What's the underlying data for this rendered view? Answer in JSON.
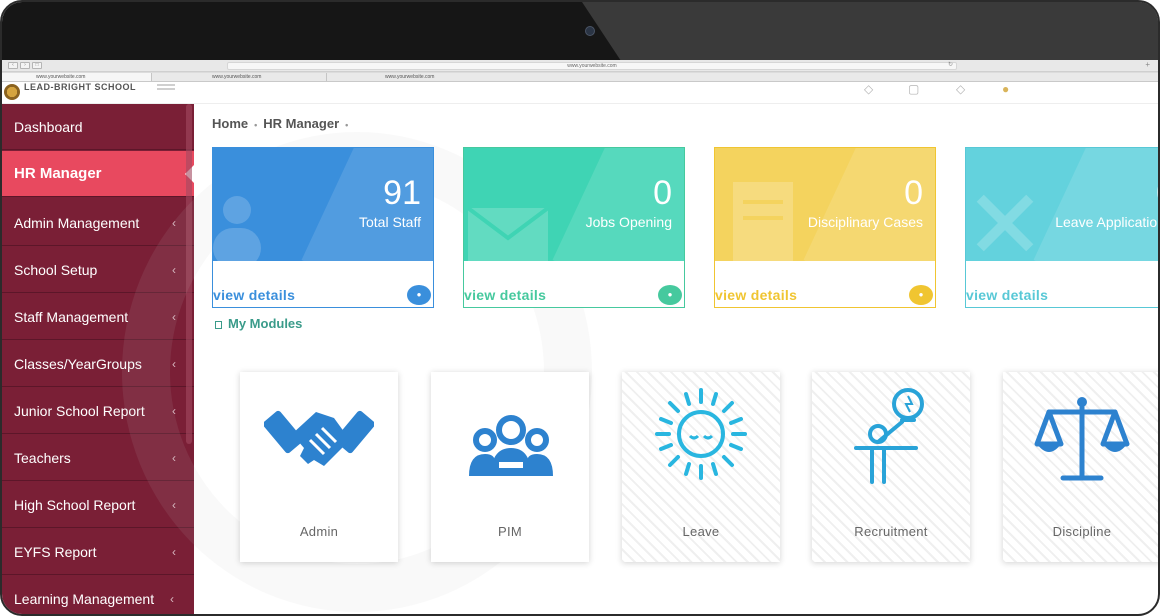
{
  "browser": {
    "address": "www.yourwebsite.com",
    "tabs": [
      "www.yourwebsite.com",
      "www.yourwebsite.com",
      "www.yourwebsite.com"
    ]
  },
  "header": {
    "brand": "LEAD-BRIGHT SCHOOL",
    "icons": [
      "bell-icon",
      "message-icon",
      "gear-icon",
      "user-icon"
    ]
  },
  "sidebar": {
    "items": [
      {
        "label": "Dashboard",
        "chevron": ""
      },
      {
        "label": "HR Manager",
        "chevron": ""
      },
      {
        "label": "Admin Management",
        "chevron": "‹"
      },
      {
        "label": "School Setup",
        "chevron": "‹"
      },
      {
        "label": "Staff Management",
        "chevron": "‹"
      },
      {
        "label": "Classes/YearGroups",
        "chevron": "‹"
      },
      {
        "label": "Junior School Report",
        "chevron": "‹"
      },
      {
        "label": "Teachers",
        "chevron": "‹"
      },
      {
        "label": "High School Report",
        "chevron": "‹"
      },
      {
        "label": "EYFS Report",
        "chevron": "‹"
      },
      {
        "label": "Learning Management",
        "chevron": "‹"
      }
    ]
  },
  "breadcrumb": {
    "home": "Home",
    "current": "HR Manager",
    "sep": "•"
  },
  "stats": [
    {
      "value": "91",
      "label": "Total Staff",
      "link": "view details",
      "color": "#3a8fdc",
      "accent": "#3a8fdc"
    },
    {
      "value": "0",
      "label": "Jobs Opening",
      "link": "view details",
      "color": "#3fd4b4",
      "accent": "#46c99e"
    },
    {
      "value": "0",
      "label": "Disciplinary Cases",
      "link": "view details",
      "color": "#f4d35e",
      "accent": "#f0c531"
    },
    {
      "value": "0",
      "label": "Leave Application",
      "link": "view details",
      "color": "#63d2dd",
      "accent": "#58c8d6"
    }
  ],
  "modules": {
    "title": "My Modules",
    "items": [
      {
        "label": "Admin",
        "icon": "handshake-icon"
      },
      {
        "label": "PIM",
        "icon": "people-group-icon"
      },
      {
        "label": "Leave",
        "icon": "sun-icon"
      },
      {
        "label": "Recruitment",
        "icon": "presenter-idea-icon"
      },
      {
        "label": "Discipline",
        "icon": "scales-icon"
      }
    ]
  }
}
